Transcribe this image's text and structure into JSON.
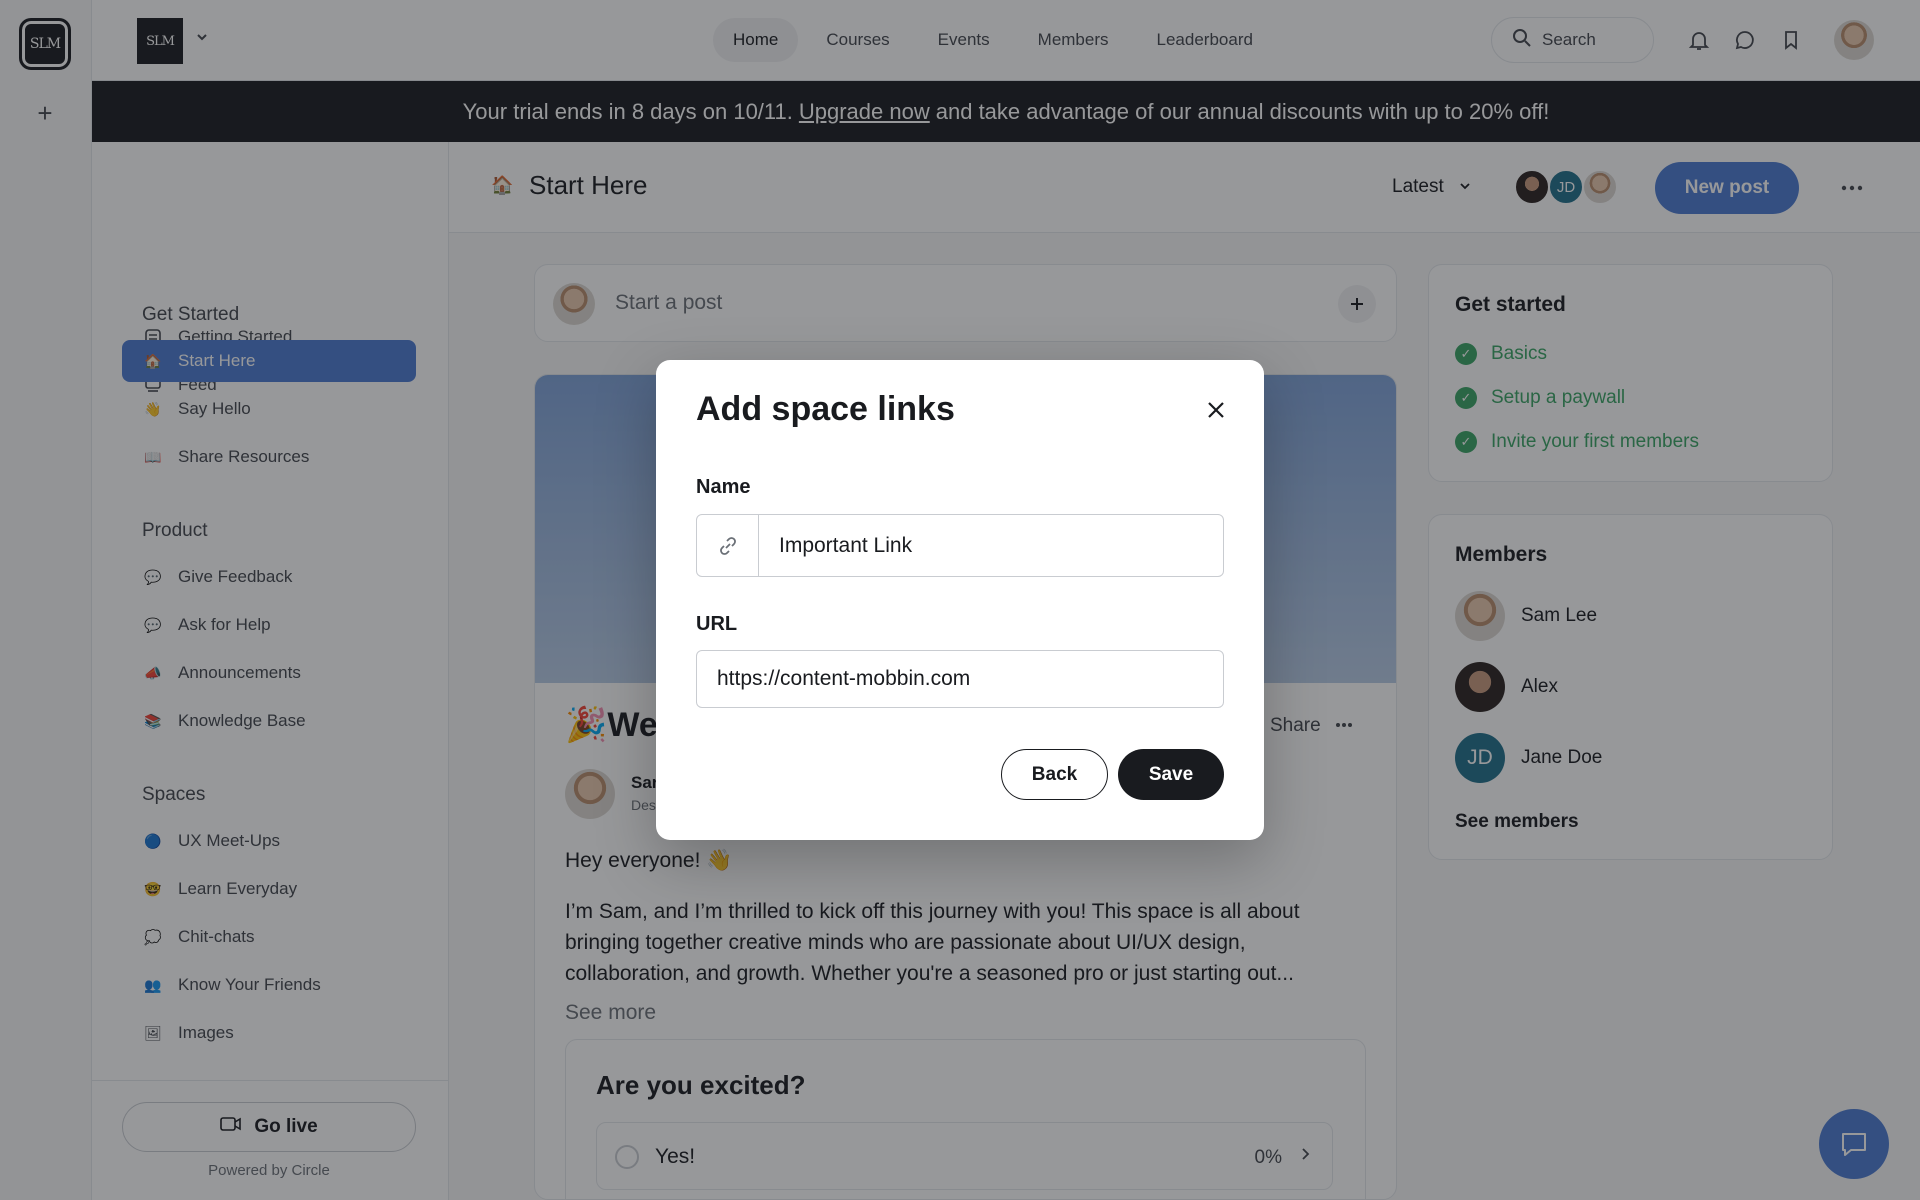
{
  "rail": {
    "logo_text": "SLM",
    "add_label": "+"
  },
  "header": {
    "brand_text": "SLM",
    "nav": [
      {
        "label": "Home",
        "active": true
      },
      {
        "label": "Courses"
      },
      {
        "label": "Events"
      },
      {
        "label": "Members"
      },
      {
        "label": "Leaderboard"
      }
    ],
    "search_label": "Search"
  },
  "banner": {
    "text_before": "Your trial ends in 8 days on 10/11.",
    "link": "Upgrade now",
    "text_after": "and take advantage of our annual discounts with up to 20% off!"
  },
  "sidebar": {
    "top_items": [
      {
        "label": "Getting Started",
        "icon": "checklist-icon"
      },
      {
        "label": "Feed",
        "icon": "feed-icon"
      }
    ],
    "sections": [
      {
        "title": "Get Started",
        "items": [
          {
            "label": "Start Here",
            "emoji": "🏠",
            "active": true
          },
          {
            "label": "Say Hello",
            "emoji": "👋"
          },
          {
            "label": "Share Resources",
            "emoji": "📖"
          }
        ]
      },
      {
        "title": "Product",
        "items": [
          {
            "label": "Give Feedback",
            "emoji": "💬"
          },
          {
            "label": "Ask for Help",
            "emoji": "💬"
          },
          {
            "label": "Announcements",
            "emoji": "📣"
          },
          {
            "label": "Knowledge Base",
            "emoji": "📚"
          }
        ]
      },
      {
        "title": "Spaces",
        "items": [
          {
            "label": "UX Meet-Ups",
            "emoji": "🔵"
          },
          {
            "label": "Learn Everyday",
            "emoji": "🤓"
          },
          {
            "label": "Chit-chats",
            "emoji": "💭"
          },
          {
            "label": "Know Your Friends",
            "emoji": "👥"
          },
          {
            "label": "Images",
            "emoji": "🖼"
          }
        ]
      }
    ],
    "go_live": "Go live",
    "powered_by": "Powered by Circle"
  },
  "space": {
    "emoji": "🏠",
    "title": "Start Here",
    "sort_label": "Latest",
    "avatar_initials": "JD",
    "new_post": "New post"
  },
  "composer": {
    "placeholder": "Start a post"
  },
  "post": {
    "title_emoji": "🎉",
    "title_visible": "Wel",
    "share": "Share",
    "author_visible": "Sar",
    "role_visible": "Des",
    "greeting": "Hey everyone! 👋",
    "body": "I’m Sam, and I’m thrilled to kick off this journey with you! This space is all about bringing together creative minds who are passionate about UI/UX design, collaboration, and growth. Whether you're a seasoned pro or just starting out...",
    "see_more": "See more",
    "poll": {
      "question": "Are you excited?",
      "options": [
        {
          "label": "Yes!",
          "percent": "0%"
        }
      ]
    }
  },
  "get_started": {
    "title": "Get started",
    "items": [
      "Basics",
      "Setup a paywall",
      "Invite your first members"
    ]
  },
  "members": {
    "title": "Members",
    "list": [
      {
        "name": "Sam Lee"
      },
      {
        "name": "Alex"
      },
      {
        "name": "Jane Doe",
        "initials": "JD"
      }
    ],
    "see_all": "See members"
  },
  "modal": {
    "title": "Add space links",
    "name_label": "Name",
    "name_value": "Important Link",
    "url_label": "URL",
    "url_value": "https://content-mobbin.com",
    "back": "Back",
    "save": "Save"
  },
  "colors": {
    "accent": "#4b7bd1",
    "dark": "#191b1f",
    "success": "#3aa564",
    "teal": "#1f6f8b"
  }
}
